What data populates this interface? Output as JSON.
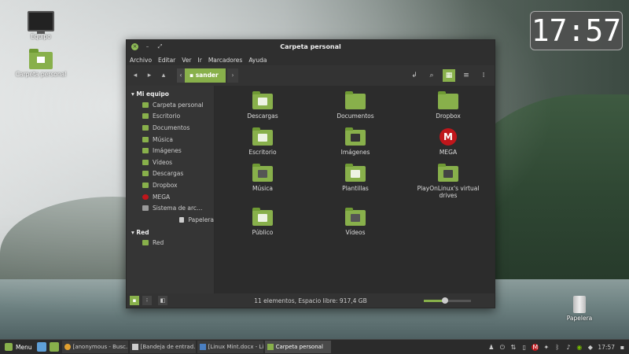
{
  "desktop": {
    "icons": [
      {
        "label": "Equipo",
        "icon": "computer-icon"
      },
      {
        "label": "Carpeta personal",
        "icon": "home-folder-icon"
      },
      {
        "label": "Papelera",
        "icon": "trash-icon"
      }
    ],
    "clock": "17:57"
  },
  "window": {
    "title": "Carpeta personal",
    "menus": [
      "Archivo",
      "Editar",
      "Ver",
      "Ir",
      "Marcadores",
      "Ayuda"
    ],
    "path": {
      "current": "sander"
    },
    "sidebar": {
      "section1": "Mi equipo",
      "items": [
        {
          "label": "Carpeta personal",
          "icon": "home-icon"
        },
        {
          "label": "Escritorio",
          "icon": "desktop-folder-icon"
        },
        {
          "label": "Documentos",
          "icon": "documents-folder-icon"
        },
        {
          "label": "Música",
          "icon": "music-folder-icon"
        },
        {
          "label": "Imágenes",
          "icon": "pictures-folder-icon"
        },
        {
          "label": "Vídeos",
          "icon": "videos-folder-icon"
        },
        {
          "label": "Descargas",
          "icon": "downloads-folder-icon"
        },
        {
          "label": "Dropbox",
          "icon": "dropbox-folder-icon"
        },
        {
          "label": "MEGA",
          "icon": "mega-icon"
        },
        {
          "label": "Sistema de arc…",
          "icon": "drive-icon"
        },
        {
          "label": "Papelera",
          "icon": "trash-icon"
        }
      ],
      "section2": "Red",
      "network_items": [
        {
          "label": "Red",
          "icon": "network-icon"
        }
      ]
    },
    "files": [
      {
        "name": "Descargas",
        "icon": "downloads-folder-icon"
      },
      {
        "name": "Documentos",
        "icon": "documents-folder-icon"
      },
      {
        "name": "Dropbox",
        "icon": "dropbox-folder-icon"
      },
      {
        "name": "Escritorio",
        "icon": "desktop-folder-icon"
      },
      {
        "name": "Imágenes",
        "icon": "pictures-folder-icon"
      },
      {
        "name": "MEGA",
        "icon": "mega-icon"
      },
      {
        "name": "Música",
        "icon": "music-folder-icon"
      },
      {
        "name": "Plantillas",
        "icon": "templates-folder-icon"
      },
      {
        "name": "PlayOnLinux's virtual drives",
        "icon": "playonlinux-folder-icon"
      },
      {
        "name": "Público",
        "icon": "public-folder-icon"
      },
      {
        "name": "Vídeos",
        "icon": "videos-folder-icon"
      }
    ],
    "status": "11 elementos, Espacio libre: 917,4 GB",
    "zoom_level": 0.45
  },
  "taskbar": {
    "menu_label": "Menu",
    "tasks": [
      {
        "label": "[anonymous - Busc…",
        "icon": "chrome-icon",
        "active": false
      },
      {
        "label": "[Bandeja de entrad…",
        "icon": "mail-icon",
        "active": false
      },
      {
        "label": "[Linux Mint.docx - Li…",
        "icon": "document-icon",
        "active": false
      },
      {
        "label": "Carpeta personal",
        "icon": "folder-icon",
        "active": true
      }
    ],
    "clock": "17:57"
  },
  "colors": {
    "accent": "#88b04b",
    "mega": "#c0161b"
  }
}
